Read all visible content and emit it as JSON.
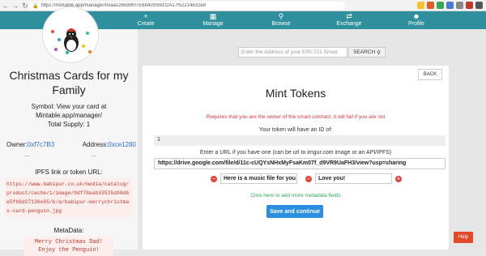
{
  "browser": {
    "url": "https://mintable.app/manager/0xaa1280d9f07E6b4cf0991f2A17f52214832e8"
  },
  "topnav": {
    "items": [
      {
        "label": "Create",
        "icon": "plus-icon"
      },
      {
        "label": "Manage",
        "icon": "grid-icon"
      },
      {
        "label": "Browse",
        "icon": "search-icon"
      },
      {
        "label": "Exchange",
        "icon": "exchange-icon"
      },
      {
        "label": "Profile",
        "icon": "user-icon"
      }
    ]
  },
  "contract": {
    "title": "Christmas Cards for my Family",
    "symbol": "Symbol: View your card at Mintable.app/manager/",
    "supply": "Total Supply: 1",
    "owner_label": "Owner:",
    "owner_value": "0xf7c7B3",
    "address_label": "Address:",
    "address_value": "0xce1280",
    "ellipsis": "...",
    "ipfs_title": "IPFS link or token URL:",
    "ipfs_link": "https://www.babipur.co.uk/media/catalog/product/cache/1/image/9df78eab33525d08d6e5fb8d27136e95/b/a/babipur-merrychristmas-card-penguin.jpg",
    "metadata_title": "MetaData:",
    "metadata_value": "Merry Christmas Dad! Enjoy the Penguin!"
  },
  "search": {
    "placeholder": "Enter the Address of your ERC721 Smart",
    "button": "SEARCH"
  },
  "mint": {
    "back": "BACK",
    "title": "Mint Tokens",
    "warning": "Requires that you are the owner of the smart contract, it will fail if you are not",
    "id_text": "Your token will have an ID of:",
    "id_value": "1",
    "url_label": "Enter a URL if you have one (can be url to imgur.com image or an API/IPFS)",
    "url_value": "https://drive.google.com/file/d/11c-cUQYsNHxMyFsaKm07f_d9VR9UaFH3/view?usp=sharing",
    "meta_key": "Here is a music file for you t",
    "meta_value": "Love you!",
    "add_metadata": "Click here to add more metadata fields",
    "save": "Save and continue"
  },
  "help": "Help"
}
